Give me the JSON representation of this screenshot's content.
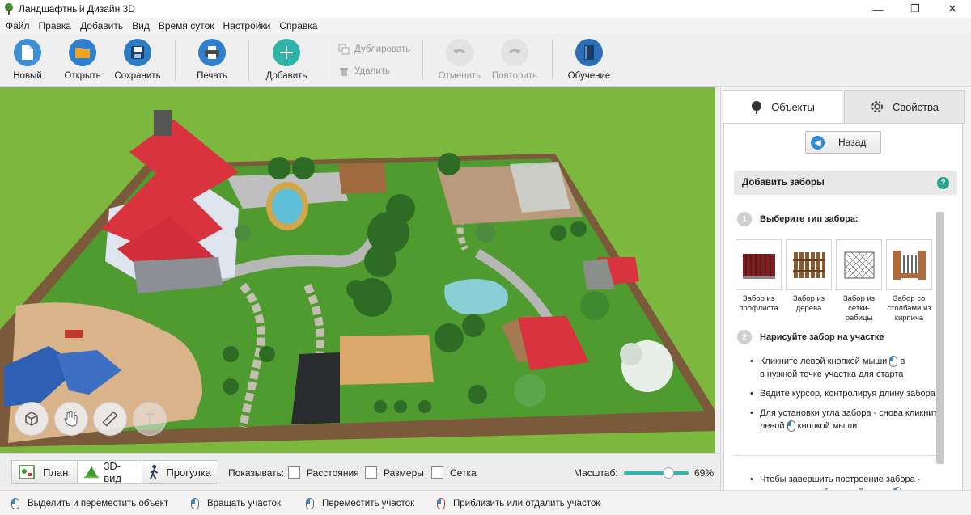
{
  "window": {
    "title": "Ландшафтный Дизайн 3D",
    "minimize": "—",
    "maximize": "❐",
    "close": "✕"
  },
  "menu": [
    "Файл",
    "Правка",
    "Добавить",
    "Вид",
    "Время суток",
    "Настройки",
    "Справка"
  ],
  "toolbar": {
    "new": "Новый",
    "open": "Открыть",
    "save": "Сохранить",
    "print": "Печать",
    "add": "Добавить",
    "duplicate": "Дублировать",
    "delete": "Удалить",
    "undo": "Отменить",
    "redo": "Повторить",
    "tutorial": "Обучение"
  },
  "panel": {
    "tabs": {
      "objects": "Объекты",
      "properties": "Свойства"
    },
    "back": "Назад",
    "section_title": "Добавить заборы",
    "help": "?",
    "step1": {
      "num": "1",
      "text": "Выберите тип забора:"
    },
    "fences": [
      {
        "caption": "Забор из профлиста",
        "icon": "profile-sheet-fence-icon"
      },
      {
        "caption": "Забор из дерева",
        "icon": "wooden-fence-icon"
      },
      {
        "caption": "Забор из сетки-рабицы",
        "icon": "chain-link-fence-icon"
      },
      {
        "caption": "Забор со столбами из кирпича",
        "icon": "brick-pillar-fence-icon"
      }
    ],
    "step2": {
      "num": "2",
      "text": "Нарисуйте забор на участке"
    },
    "instructions": {
      "b1a": "Кликните левой кнопкой мыши",
      "b1b": "в нужной точке участка для старта",
      "b2": "Ведите курсор, контролируя длину забора",
      "b3a": "Для установки угла забора - снова кликните",
      "b3b": "левой",
      "b3c": "кнопкой мыши",
      "b4a": "Чтобы завершить построение забора -",
      "b4b": "кликните правой кнопкой мыши"
    }
  },
  "bottom": {
    "view_plan": "План",
    "view_3d": "3D-вид",
    "view_walk": "Прогулка",
    "show_label": "Показывать:",
    "distances": "Расстояния",
    "sizes": "Размеры",
    "grid": "Сетка",
    "scale_label": "Масштаб:",
    "scale_value": "69%",
    "scale_fraction": 0.69
  },
  "status": {
    "select_move": "Выделить и переместить объект",
    "rotate": "Вращать участок",
    "move": "Переместить участок",
    "zoom": "Приблизить или отдалить участок"
  },
  "colors": {
    "accent_teal": "#29b7b0",
    "roof_red": "#d9333f",
    "lawn_green": "#4f9b2f",
    "save_blue": "#2b7cc6",
    "open_orange": "#f4a41c"
  }
}
